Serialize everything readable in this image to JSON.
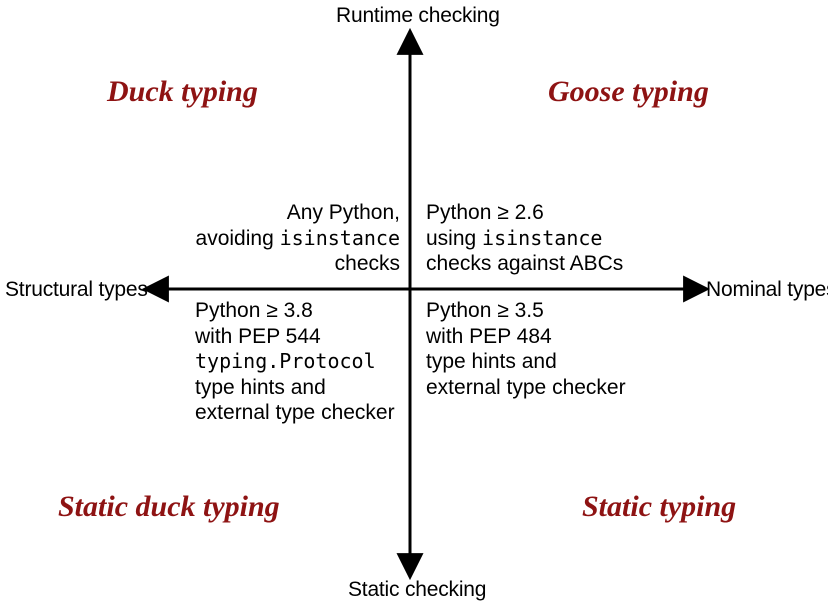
{
  "axes": {
    "top": "Runtime checking",
    "bottom": "Static checking",
    "left": "Structural types",
    "right": "Nominal types"
  },
  "quadrants": {
    "tl": {
      "title": "Duck typing",
      "desc_l1": "Any Python,",
      "desc_l2a": "avoiding ",
      "desc_l2_code": "isinstance",
      "desc_l3": "checks"
    },
    "tr": {
      "title": "Goose typing",
      "desc_l1": "Python ≥ 2.6",
      "desc_l2a": "using ",
      "desc_l2_code": "isinstance",
      "desc_l3": "checks against ABCs"
    },
    "bl": {
      "title": "Static duck typing",
      "desc_l1": "Python ≥ 3.8",
      "desc_l2": "with PEP 544",
      "desc_l3_code": "typing.Protocol",
      "desc_l4": "type hints and",
      "desc_l5": "external type checker"
    },
    "br": {
      "title": "Static typing",
      "desc_l1": "Python ≥ 3.5",
      "desc_l2": "with PEP 484",
      "desc_l3": "type hints and",
      "desc_l4": "external type checker"
    }
  }
}
